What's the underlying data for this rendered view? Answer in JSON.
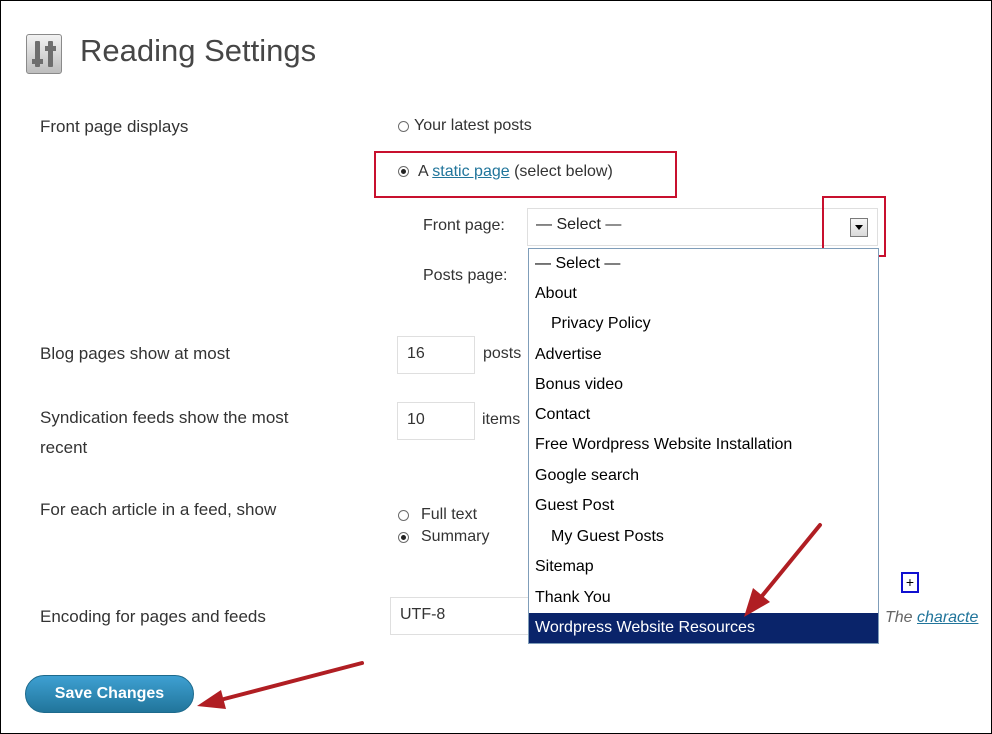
{
  "page": {
    "title": "Reading Settings"
  },
  "front_page_displays": {
    "label": "Front page displays",
    "option_latest": "Your latest posts",
    "option_static_prefix": "A",
    "option_static_link": "static page",
    "option_static_suffix": "(select below)",
    "front_page_label": "Front page:",
    "front_page_value": "— Select —",
    "posts_page_label": "Posts page:"
  },
  "dropdown": {
    "options": [
      {
        "label": "— Select —"
      },
      {
        "label": "About"
      },
      {
        "label": "Privacy Policy"
      },
      {
        "label": "Advertise"
      },
      {
        "label": "Bonus video"
      },
      {
        "label": "Contact"
      },
      {
        "label": "Free Wordpress Website Installation"
      },
      {
        "label": "Google search"
      },
      {
        "label": "Guest Post"
      },
      {
        "label": "My Guest Posts"
      },
      {
        "label": "Sitemap"
      },
      {
        "label": "Thank You"
      },
      {
        "label": "Wordpress Website Resources"
      }
    ],
    "selected": "Wordpress Website Resources"
  },
  "blog_pages": {
    "label": "Blog pages show at most",
    "value": "16",
    "unit": "posts"
  },
  "syndication": {
    "label_line1": "Syndication feeds show the most",
    "label_line2": "recent",
    "value": "10",
    "unit": "items"
  },
  "feed_article": {
    "label": "For each article in a feed, show",
    "option_full": "Full text",
    "option_summary": "Summary"
  },
  "encoding": {
    "label": "Encoding for pages and feeds",
    "value": "UTF-8",
    "desc_prefix": "The",
    "desc_link": "characte"
  },
  "plus_box": {
    "symbol": "+"
  },
  "actions": {
    "save_label": "Save Changes"
  },
  "colors": {
    "annotation_red": "#c8102e",
    "link_blue": "#21759b",
    "selected_bg": "#0a246a",
    "button_blue": "#21759b"
  }
}
